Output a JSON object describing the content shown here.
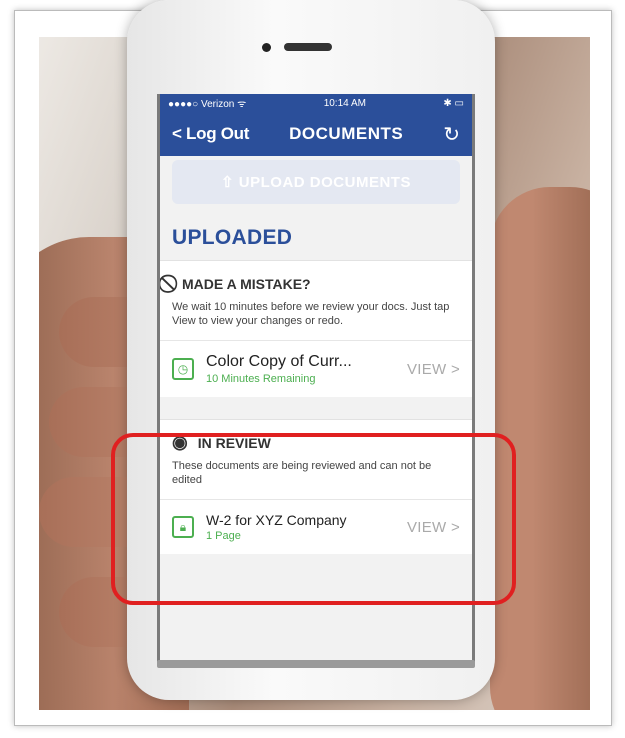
{
  "status_bar": {
    "carrier": "●●●●○ Verizon ᯤ",
    "time": "10:14 AM",
    "right": "✱ ▭"
  },
  "nav": {
    "back_label": "< Log Out",
    "title": "DOCUMENTS",
    "refresh_icon": "refresh-icon"
  },
  "upload_label": "⇧ UPLOAD DOCUMENTS",
  "section_title": "UPLOADED",
  "mistake": {
    "heading": "MADE A MISTAKE?",
    "description": "We wait 10 minutes before we review your docs. Just tap View to view your changes or redo."
  },
  "doc1": {
    "title": "Color Copy of Curr...",
    "subtitle": "10 Minutes Remaining",
    "view": "VIEW >"
  },
  "review": {
    "heading": "IN REVIEW",
    "description": "These documents are being reviewed and can not be edited"
  },
  "doc2": {
    "title": "W-2 for XYZ Company",
    "subtitle": "1 Page",
    "view": "VIEW >"
  },
  "colors": {
    "brand": "#2b4f9a",
    "accent_green": "#4caf50",
    "highlight": "#e02020"
  }
}
